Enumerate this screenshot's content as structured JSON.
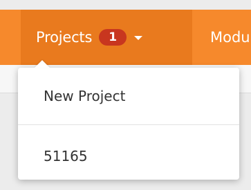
{
  "navbar": {
    "projects_label": "Projects",
    "projects_badge": "1",
    "next_label": "Modu"
  },
  "projects_menu": {
    "items": [
      {
        "label": "New Project"
      },
      {
        "label": "51165"
      }
    ]
  },
  "colors": {
    "navbar_bg": "#f6892c",
    "active_nav_bg": "#e97a1e",
    "badge_bg": "#c8361f"
  },
  "icons": {
    "dropdown_caret": "chevron-down-icon"
  }
}
